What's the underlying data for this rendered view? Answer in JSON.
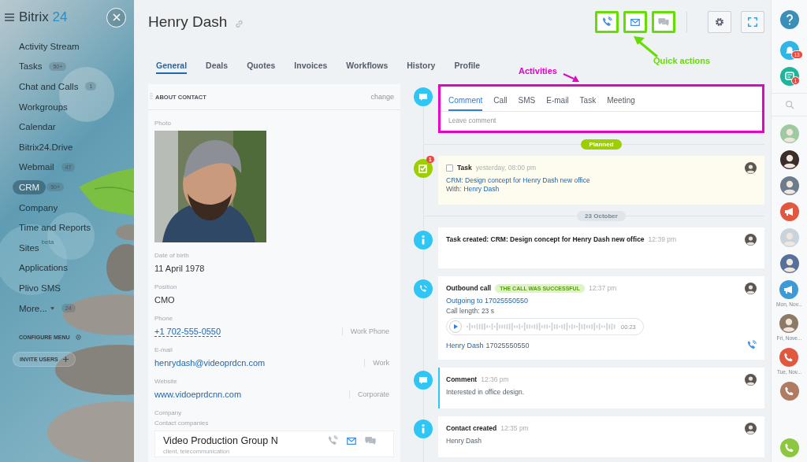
{
  "sidebar": {
    "logo": {
      "name": "Bitrix",
      "number": "24"
    },
    "items": [
      {
        "label": "Activity Stream",
        "selected": false
      },
      {
        "label": "Tasks",
        "badge": "50+",
        "selected": false
      },
      {
        "label": "Chat and Calls",
        "badge": "1",
        "selected": false
      },
      {
        "label": "Workgroups",
        "selected": false
      },
      {
        "label": "Calendar",
        "selected": false
      },
      {
        "label": "Bitrix24.Drive",
        "selected": false
      },
      {
        "label": "Webmail",
        "badge": "47",
        "selected": false
      },
      {
        "label": "CRM",
        "badge": "50+",
        "selected": true
      },
      {
        "label": "Company",
        "selected": false
      },
      {
        "label": "Time and Reports",
        "selected": false
      },
      {
        "label": "Sites",
        "tag": "beta",
        "selected": false
      },
      {
        "label": "Applications",
        "selected": false
      },
      {
        "label": "Plivo SMS",
        "selected": false
      },
      {
        "label": "More...",
        "badge": "24",
        "dropdown": true,
        "selected": false
      }
    ],
    "configure": "CONFIGURE MENU",
    "invite": "INVITE USERS"
  },
  "header": {
    "title": "Henry Dash",
    "quick_actions": [
      {
        "kind": "call",
        "active": true,
        "highlighted": true
      },
      {
        "kind": "email",
        "active": true,
        "highlighted": true
      },
      {
        "kind": "chat",
        "active": false,
        "highlighted": true
      }
    ],
    "tools": [
      {
        "kind": "settings"
      },
      {
        "kind": "fullscreen"
      }
    ]
  },
  "tabs": [
    {
      "label": "General",
      "selected": true
    },
    {
      "label": "Deals",
      "selected": false
    },
    {
      "label": "Quotes",
      "selected": false
    },
    {
      "label": "Invoices",
      "selected": false
    },
    {
      "label": "Workflows",
      "selected": false
    },
    {
      "label": "History",
      "selected": false
    },
    {
      "label": "Profile",
      "selected": false
    }
  ],
  "about": {
    "title": "ABOUT CONTACT",
    "action": "change",
    "photo_label": "Photo",
    "fields": [
      {
        "label": "Date of birth",
        "value": "11 April 1978",
        "kind": "text"
      },
      {
        "label": "Position",
        "value": "CMO",
        "kind": "text"
      },
      {
        "label": "Phone",
        "value": "+1 702-555-0550",
        "kind": "phone",
        "type": "Work Phone"
      },
      {
        "label": "E-mail",
        "value": "henrydash@videoprdcn.com",
        "kind": "link",
        "type": "Work"
      },
      {
        "label": "Website",
        "value": "www.vidoeprdcnn.com",
        "kind": "link",
        "type": "Corporate"
      }
    ],
    "company": {
      "label": "Company",
      "sublabel": "Contact companies",
      "name": "Video Production Group N",
      "subtitle": "client, telecommunication",
      "actions": [
        {
          "kind": "call",
          "active": false
        },
        {
          "kind": "email",
          "active": true
        },
        {
          "kind": "chat",
          "active": false
        }
      ]
    }
  },
  "composer": {
    "highlighted": true,
    "tabs": [
      {
        "label": "Comment",
        "selected": true
      },
      {
        "label": "Call",
        "selected": false
      },
      {
        "label": "SMS",
        "selected": false
      },
      {
        "label": "E-mail",
        "selected": false
      },
      {
        "label": "Task",
        "selected": false
      },
      {
        "label": "Meeting",
        "selected": false
      }
    ],
    "placeholder": "Leave comment"
  },
  "timeline": [
    {
      "kind": "planned",
      "label": "Planned"
    },
    {
      "kind": "task",
      "badge": "1",
      "checked": false,
      "title": "Task",
      "time": "yesterday, 08:00 pm",
      "link": "CRM: Design concept for Henry Dash new office",
      "with_label": "With:",
      "with_link": "Henry Dash"
    },
    {
      "kind": "date",
      "label": "23 October"
    },
    {
      "kind": "info",
      "title": "Task created: CRM: Design concept for Henry Dash new office",
      "time": "12:39 pm"
    },
    {
      "kind": "call",
      "title": "Outbound call",
      "status": "THE CALL WAS SUCCESSFUL",
      "time": "12:37 pm",
      "link": "Outgoing to 17025550550",
      "length": "Call length: 23 s",
      "duration": "00:23",
      "contact": "Henry Dash",
      "number": "17025550550"
    },
    {
      "kind": "comment",
      "title": "Comment",
      "time": "12:36 pm",
      "text": "Interested in office design."
    },
    {
      "kind": "info",
      "title": "Contact created",
      "time": "12:35 pm",
      "text": "Henry Dash"
    }
  ],
  "annotations": [
    {
      "kind": "quick_actions",
      "text": "Quick actions",
      "color": "#66dd00"
    },
    {
      "kind": "activities",
      "text": "Activities",
      "color": "#e600c8"
    }
  ],
  "right_bar": [
    {
      "kind": "help"
    },
    {
      "kind": "notifications",
      "badge": "13"
    },
    {
      "kind": "messages",
      "badge": "1"
    },
    {
      "kind": "search"
    },
    {
      "kind": "avatar",
      "color": "#9fc9a0"
    },
    {
      "kind": "avatar",
      "color": "#3b2e2a"
    },
    {
      "kind": "avatar",
      "color": "#6d7b8c"
    },
    {
      "kind": "megaphone",
      "color": "#e2583e"
    },
    {
      "kind": "avatar",
      "color": "#c9d3dc"
    },
    {
      "kind": "avatar",
      "color": "#55709a"
    },
    {
      "kind": "megaphone",
      "color": "#3d9ad6",
      "label": "Mon, Nov..."
    },
    {
      "kind": "avatar",
      "color": "#8c7a66",
      "label": "Fri, Nove..."
    },
    {
      "kind": "call",
      "color": "#e2583e",
      "label": "Tue, Nov..."
    },
    {
      "kind": "call",
      "color": "#b07a63"
    },
    {
      "kind": "phone",
      "color": "#8dc63f"
    }
  ]
}
